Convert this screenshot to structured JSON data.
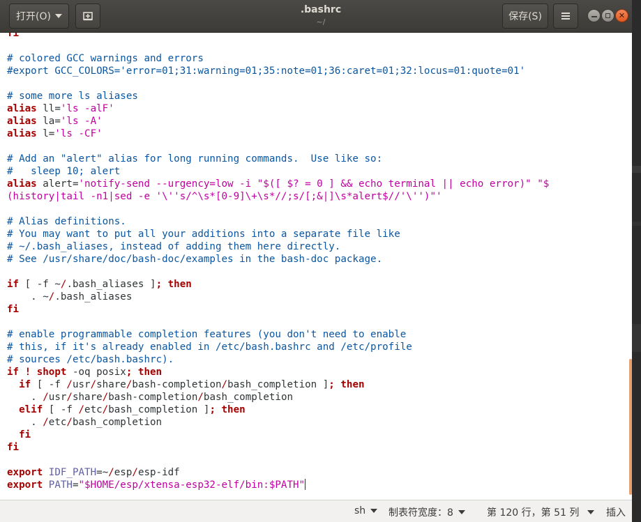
{
  "header": {
    "open_label": "打开(O)",
    "newdoc_icon": "new-document-icon",
    "title": ".bashrc",
    "subtitle": "~/",
    "save_label": "保存(S)",
    "menu_icon": "hamburger-menu-icon",
    "window_controls": [
      "minimize-icon",
      "maximize-icon",
      "close-icon"
    ]
  },
  "editor": {
    "lines": [
      {
        "segs": [
          {
            "t": "fi",
            "c": "kw"
          }
        ]
      },
      {
        "segs": []
      },
      {
        "segs": [
          {
            "t": "# colored GCC warnings and errors",
            "c": "cmt"
          }
        ]
      },
      {
        "segs": [
          {
            "t": "#export GCC_COLORS='error=01;31:warning=01;35:note=01;36:caret=01;32:locus=01:quote=01'",
            "c": "cmt"
          }
        ]
      },
      {
        "segs": []
      },
      {
        "segs": [
          {
            "t": "# some more ls aliases",
            "c": "cmt"
          }
        ]
      },
      {
        "segs": [
          {
            "t": "alias",
            "c": "kw"
          },
          {
            "t": " ll=",
            "c": ""
          },
          {
            "t": "'ls -alF'",
            "c": "str"
          }
        ]
      },
      {
        "segs": [
          {
            "t": "alias",
            "c": "kw"
          },
          {
            "t": " la=",
            "c": ""
          },
          {
            "t": "'ls -A'",
            "c": "str"
          }
        ]
      },
      {
        "segs": [
          {
            "t": "alias",
            "c": "kw"
          },
          {
            "t": " l=",
            "c": ""
          },
          {
            "t": "'ls -CF'",
            "c": "str"
          }
        ]
      },
      {
        "segs": []
      },
      {
        "segs": [
          {
            "t": "# Add an \"alert\" alias for long running commands.  Use like so:",
            "c": "cmt"
          }
        ]
      },
      {
        "segs": [
          {
            "t": "#   sleep 10; alert",
            "c": "cmt"
          }
        ]
      },
      {
        "segs": [
          {
            "t": "alias",
            "c": "kw"
          },
          {
            "t": " alert=",
            "c": ""
          },
          {
            "t": "'notify-send --urgency=low -i \"$([ $? = 0 ] && echo terminal || echo error)\" \"$",
            "c": "str"
          }
        ]
      },
      {
        "segs": [
          {
            "t": "(history|tail -n1|sed -e '\\''s/^\\s*[0-9]\\+\\s*//;s/[;&|]\\s*alert$//'\\'')\"'",
            "c": "str"
          }
        ]
      },
      {
        "segs": []
      },
      {
        "segs": [
          {
            "t": "# Alias definitions.",
            "c": "cmt"
          }
        ]
      },
      {
        "segs": [
          {
            "t": "# You may want to put all your additions into a separate file like",
            "c": "cmt"
          }
        ]
      },
      {
        "segs": [
          {
            "t": "# ~/.bash_aliases, instead of adding them here directly.",
            "c": "cmt"
          }
        ]
      },
      {
        "segs": [
          {
            "t": "# See /usr/share/doc/bash-doc/examples in the bash-doc package.",
            "c": "cmt"
          }
        ]
      },
      {
        "segs": []
      },
      {
        "segs": [
          {
            "t": "if",
            "c": "kw"
          },
          {
            "t": " [ -f ~",
            "c": ""
          },
          {
            "t": "/",
            "c": "path"
          },
          {
            "t": ".bash_aliases ]",
            "c": ""
          },
          {
            "t": "; then",
            "c": "kw"
          }
        ]
      },
      {
        "segs": [
          {
            "t": "    . ~",
            "c": ""
          },
          {
            "t": "/",
            "c": "path"
          },
          {
            "t": ".bash_aliases",
            "c": ""
          }
        ]
      },
      {
        "segs": [
          {
            "t": "fi",
            "c": "kw"
          }
        ]
      },
      {
        "segs": []
      },
      {
        "segs": [
          {
            "t": "# enable programmable completion features (you don't need to enable",
            "c": "cmt"
          }
        ]
      },
      {
        "segs": [
          {
            "t": "# this, if it's already enabled in /etc/bash.bashrc and /etc/profile",
            "c": "cmt"
          }
        ]
      },
      {
        "segs": [
          {
            "t": "# sources /etc/bash.bashrc).",
            "c": "cmt"
          }
        ]
      },
      {
        "segs": [
          {
            "t": "if ! shopt",
            "c": "kw"
          },
          {
            "t": " -oq posix",
            "c": ""
          },
          {
            "t": "; then",
            "c": "kw"
          }
        ]
      },
      {
        "segs": [
          {
            "t": "  if",
            "c": "kw"
          },
          {
            "t": " [ -f ",
            "c": ""
          },
          {
            "t": "/",
            "c": "path"
          },
          {
            "t": "usr",
            "c": ""
          },
          {
            "t": "/",
            "c": "path"
          },
          {
            "t": "share",
            "c": ""
          },
          {
            "t": "/",
            "c": "path"
          },
          {
            "t": "bash-completion",
            "c": ""
          },
          {
            "t": "/",
            "c": "path"
          },
          {
            "t": "bash_completion ]",
            "c": ""
          },
          {
            "t": "; then",
            "c": "kw"
          }
        ]
      },
      {
        "segs": [
          {
            "t": "    . ",
            "c": ""
          },
          {
            "t": "/",
            "c": "path"
          },
          {
            "t": "usr",
            "c": ""
          },
          {
            "t": "/",
            "c": "path"
          },
          {
            "t": "share",
            "c": ""
          },
          {
            "t": "/",
            "c": "path"
          },
          {
            "t": "bash-completion",
            "c": ""
          },
          {
            "t": "/",
            "c": "path"
          },
          {
            "t": "bash_completion",
            "c": ""
          }
        ]
      },
      {
        "segs": [
          {
            "t": "  elif",
            "c": "kw"
          },
          {
            "t": " [ -f ",
            "c": ""
          },
          {
            "t": "/",
            "c": "path"
          },
          {
            "t": "etc",
            "c": ""
          },
          {
            "t": "/",
            "c": "path"
          },
          {
            "t": "bash_completion ]",
            "c": ""
          },
          {
            "t": "; then",
            "c": "kw"
          }
        ]
      },
      {
        "segs": [
          {
            "t": "    . ",
            "c": ""
          },
          {
            "t": "/",
            "c": "path"
          },
          {
            "t": "etc",
            "c": ""
          },
          {
            "t": "/",
            "c": "path"
          },
          {
            "t": "bash_completion",
            "c": ""
          }
        ]
      },
      {
        "segs": [
          {
            "t": "  fi",
            "c": "kw"
          }
        ]
      },
      {
        "segs": [
          {
            "t": "fi",
            "c": "kw"
          }
        ]
      },
      {
        "segs": []
      },
      {
        "segs": [
          {
            "t": "export",
            "c": "kw"
          },
          {
            "t": " IDF_PATH",
            "c": "var"
          },
          {
            "t": "=~",
            "c": ""
          },
          {
            "t": "/",
            "c": "path"
          },
          {
            "t": "esp",
            "c": ""
          },
          {
            "t": "/",
            "c": "path"
          },
          {
            "t": "esp-idf",
            "c": ""
          }
        ]
      },
      {
        "segs": [
          {
            "t": "export",
            "c": "kw"
          },
          {
            "t": " PATH",
            "c": "var"
          },
          {
            "t": "=",
            "c": ""
          },
          {
            "t": "\"$HOME/esp/xtensa-esp32-elf/bin:$PATH\"",
            "c": "str"
          }
        ]
      }
    ]
  },
  "statusbar": {
    "language": "sh",
    "tab_width": "制表符宽度：8",
    "position": "第 120 行，第 51 列",
    "mode": "插入"
  },
  "colors": {
    "comment": "#0b56a0",
    "keyword": "#a40000",
    "string": "#c000a0",
    "variable": "#5f5fa6",
    "headerbar": "#3c3b37"
  }
}
